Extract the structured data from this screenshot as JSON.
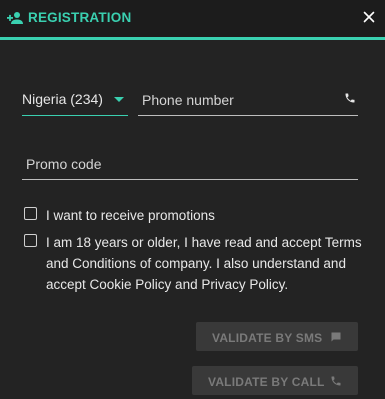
{
  "header": {
    "title": "REGISTRATION",
    "icon": "person-add-icon",
    "close_icon": "close-icon",
    "accent_color": "#3ad0b0"
  },
  "form": {
    "country": {
      "selected": "Nigeria (234)"
    },
    "phone": {
      "value": "",
      "placeholder": "Phone number",
      "icon": "phone-icon"
    },
    "promo": {
      "value": "",
      "placeholder": "Promo code"
    },
    "checkboxes": [
      {
        "label": "I want to receive promotions",
        "checked": false
      },
      {
        "label": "I am 18 years or older, I have read and accept Terms and Conditions of company. I also understand and accept Cookie Policy and Privacy Policy.",
        "checked": false
      }
    ]
  },
  "actions": {
    "sms_label": "VALIDATE BY SMS",
    "sms_icon": "message-icon",
    "call_label": "VALIDATE BY CALL",
    "call_icon": "phone-icon"
  }
}
